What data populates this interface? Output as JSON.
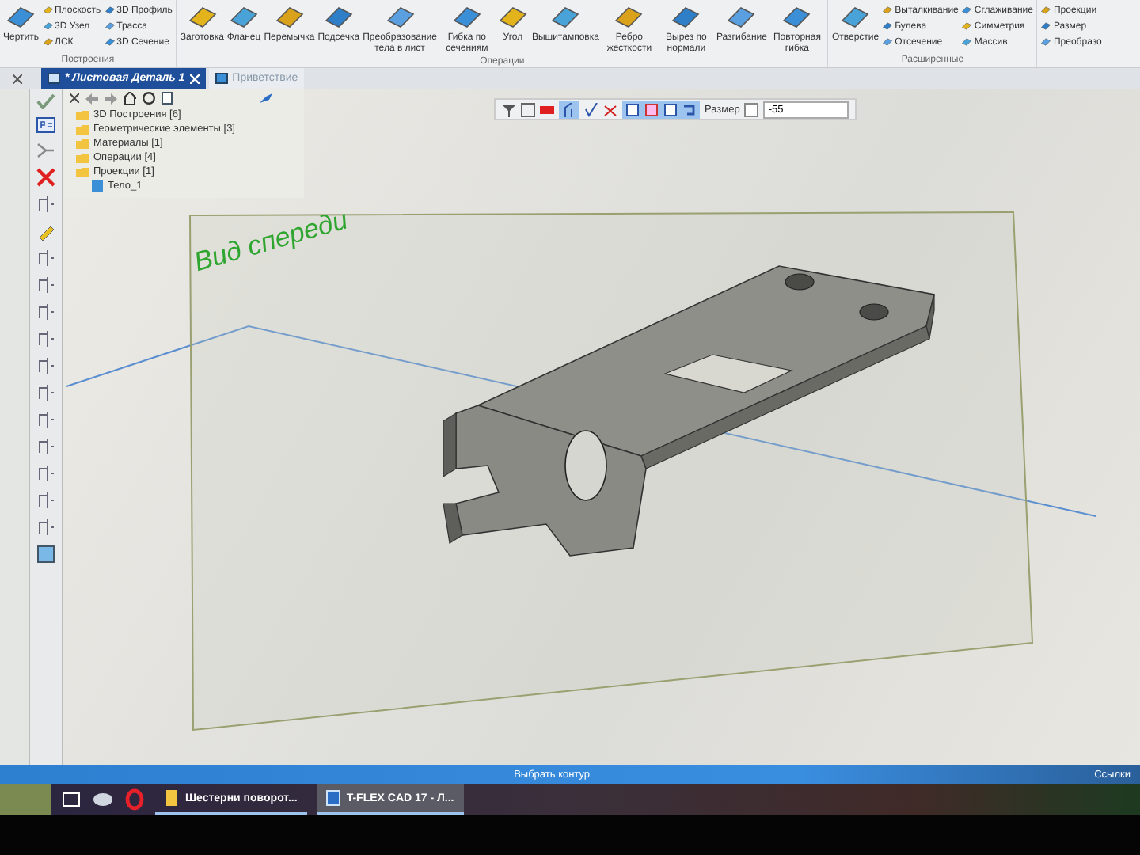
{
  "ribbon": {
    "groups": [
      {
        "label": "Построения",
        "items": [
          {
            "kind": "large",
            "label": "Чертить"
          },
          {
            "kind": "small",
            "label": "Плоскость"
          },
          {
            "kind": "small",
            "label": "3D Узел"
          },
          {
            "kind": "small",
            "label": "ЛСК"
          },
          {
            "kind": "small",
            "label": "3D Профиль"
          },
          {
            "kind": "small",
            "label": "Трасса"
          },
          {
            "kind": "small",
            "label": "3D Сечение"
          }
        ]
      },
      {
        "label": "Операции",
        "items": [
          {
            "kind": "large",
            "label": "Заготовка"
          },
          {
            "kind": "large",
            "label": "Фланец"
          },
          {
            "kind": "large",
            "label": "Перемычка"
          },
          {
            "kind": "large",
            "label": "Подсечка"
          },
          {
            "kind": "large",
            "label": "Преобразование тела в лист"
          },
          {
            "kind": "large",
            "label": "Гибка по сечениям"
          },
          {
            "kind": "large",
            "label": "Угол"
          },
          {
            "kind": "large",
            "label": "Вышитамповка"
          },
          {
            "kind": "large",
            "label": "Ребро жесткости"
          },
          {
            "kind": "large",
            "label": "Вырез по нормали"
          },
          {
            "kind": "large",
            "label": "Разгибание"
          },
          {
            "kind": "large",
            "label": "Повторная гибка"
          }
        ]
      },
      {
        "label": "Расширенные",
        "items": [
          {
            "kind": "large",
            "label": "Отверстие"
          },
          {
            "kind": "small",
            "label": "Выталкивание"
          },
          {
            "kind": "small",
            "label": "Булева"
          },
          {
            "kind": "small",
            "label": "Отсечение"
          },
          {
            "kind": "small",
            "label": "Сглаживание"
          },
          {
            "kind": "small",
            "label": "Симметрия"
          },
          {
            "kind": "small",
            "label": "Массив"
          }
        ]
      },
      {
        "items": [
          {
            "kind": "small",
            "label": "Проекции"
          },
          {
            "kind": "small",
            "label": "Размер"
          },
          {
            "kind": "small",
            "label": "Преобразо"
          }
        ]
      }
    ]
  },
  "tabs": [
    {
      "label": "* Листовая Деталь 1",
      "selected": true
    },
    {
      "label": "Приветствие",
      "selected": false
    }
  ],
  "tree": {
    "items": [
      {
        "kind": "folder",
        "label": "3D Построения [6]"
      },
      {
        "kind": "folder",
        "label": "Геометрические элементы [3]"
      },
      {
        "kind": "folder",
        "label": "Материалы [1]"
      },
      {
        "kind": "folder",
        "label": "Операции [4]"
      },
      {
        "kind": "folder",
        "label": "Проекции [1]"
      },
      {
        "kind": "body",
        "label": "Тело_1"
      }
    ]
  },
  "view_toolbar": {
    "size_label": "Размер",
    "size_checked": false,
    "size_value": "-55"
  },
  "viewport": {
    "view_label": "Вид спереди"
  },
  "status_bar": {
    "prompt": "Выбрать контур",
    "links": "Ссылки"
  },
  "taskbar": {
    "items": [
      {
        "label": "Шестерни поворот...",
        "selected": false
      },
      {
        "label": "T-FLEX CAD 17 - Л...",
        "selected": true
      }
    ]
  }
}
